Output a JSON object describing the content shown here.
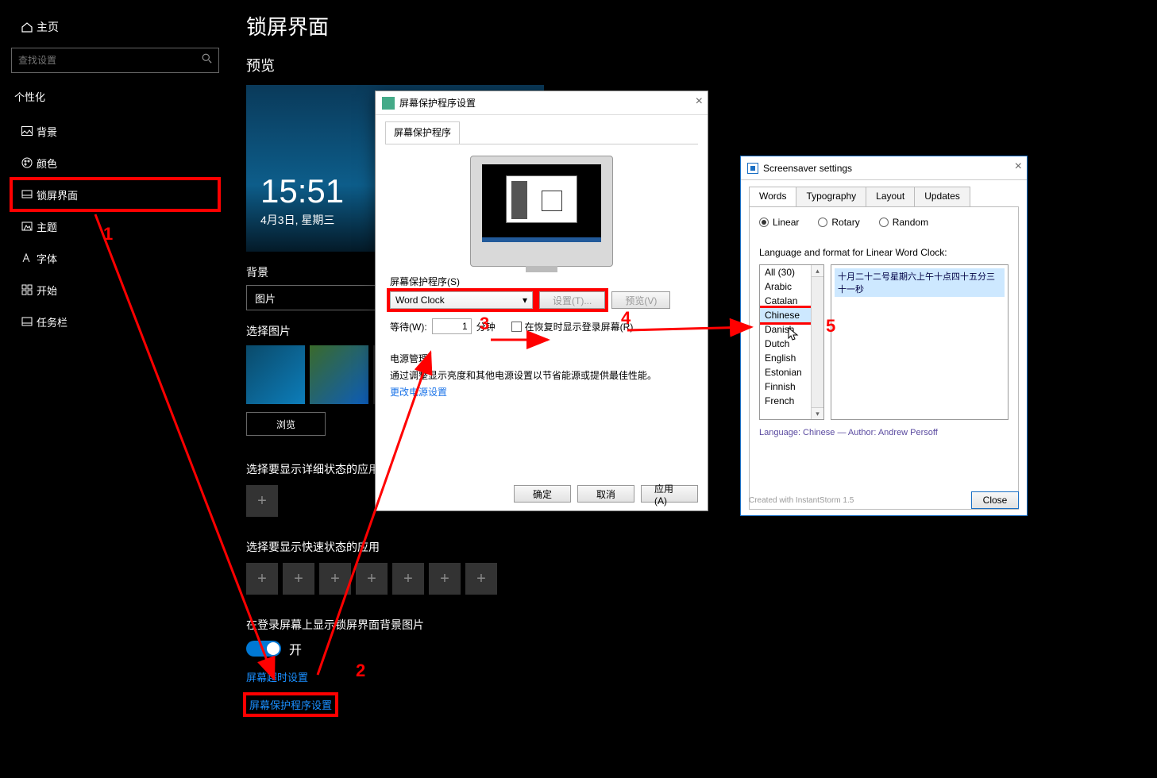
{
  "sidebar": {
    "home": "主页",
    "search_placeholder": "查找设置",
    "section": "个性化",
    "items": [
      {
        "label": "背景"
      },
      {
        "label": "颜色"
      },
      {
        "label": "锁屏界面"
      },
      {
        "label": "主题"
      },
      {
        "label": "字体"
      },
      {
        "label": "开始"
      },
      {
        "label": "任务栏"
      }
    ]
  },
  "main": {
    "title": "锁屏界面",
    "preview_label": "预览",
    "preview_time": "15:51",
    "preview_date": "4月3日, 星期三",
    "bg_label": "背景",
    "bg_value": "图片",
    "choose_img": "选择图片",
    "browse": "浏览",
    "detail_app": "选择要显示详细状态的应用",
    "quick_app": "选择要显示快速状态的应用",
    "show_bg_on_login": "在登录屏幕上显示锁屏界面背景图片",
    "toggle_on": "开",
    "timeout_link": "屏幕超时设置",
    "screensaver_link": "屏幕保护程序设置"
  },
  "dlg1": {
    "title": "屏幕保护程序设置",
    "tab": "屏幕保护程序",
    "ss_label": "屏幕保护程序(S)",
    "ss_value": "Word Clock",
    "settings_btn": "设置(T)...",
    "preview_btn": "预览(V)",
    "wait_label": "等待(W):",
    "wait_value": "1",
    "wait_unit": "分钟",
    "resume_chk": "在恢复时显示登录屏幕(R)",
    "power_section": "电源管理",
    "power_text": "通过调整显示亮度和其他电源设置以节省能源或提供最佳性能。",
    "power_link": "更改电源设置",
    "ok": "确定",
    "cancel": "取消",
    "apply": "应用(A)"
  },
  "dlg2": {
    "title": "Screensaver settings",
    "tabs": [
      "Words",
      "Typography",
      "Layout",
      "Updates"
    ],
    "radios": [
      "Linear",
      "Rotary",
      "Random"
    ],
    "lf_label": "Language and format for Linear Word Clock:",
    "langs": [
      "All (30)",
      "Arabic",
      "Catalan",
      "Chinese",
      "Danish",
      "Dutch",
      "English",
      "Estonian",
      "Finnish",
      "French"
    ],
    "selected_lang_index": 3,
    "preview_text": "十月二十二号星期六上午十点四十五分三十一秒",
    "author_line": "Language: Chinese — Author: Andrew Persoff",
    "made": "Created with InstantStorm 1.5",
    "close": "Close"
  },
  "ann": {
    "n1": "1",
    "n2": "2",
    "n3": "3",
    "n4": "4",
    "n5": "5"
  }
}
